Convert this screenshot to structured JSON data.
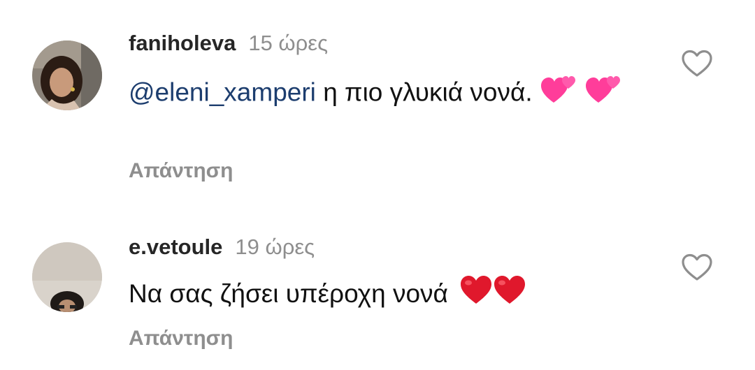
{
  "comments": [
    {
      "username": "faniholeva",
      "time": "15 ώρες",
      "mention": "@eleni_xamperi",
      "text": "η πιο γλυκιά νονά.",
      "emoji": [
        "two-hearts",
        "two-hearts"
      ],
      "reply_label": "Απάντηση",
      "liked": false
    },
    {
      "username": "e.vetoule",
      "time": "19 ώρες",
      "text": "Να σας ζήσει υπέροχη νονά",
      "emoji": [
        "red-heart",
        "red-heart"
      ],
      "reply_label": "Απάντηση",
      "liked": false
    }
  ],
  "colors": {
    "mention": "#1c3d6e",
    "meta_gray": "#8e8e8e",
    "heart_pink": "#ff3d9a",
    "heart_red": "#e0182c"
  },
  "icons": {
    "like": "heart-outline-icon"
  }
}
